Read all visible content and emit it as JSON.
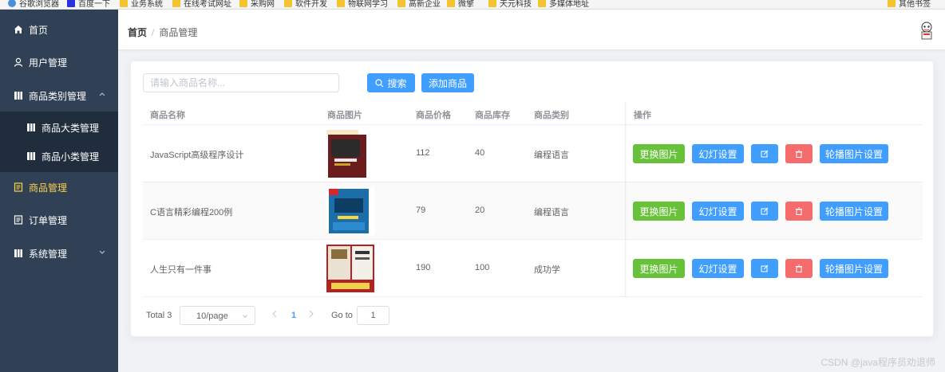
{
  "bookmarks": [
    "谷歌浏览器",
    "百度一下",
    "业务系统",
    "在线考试网址",
    "采购网",
    "软件开发",
    "物联网学习",
    "高新企业",
    "微擎",
    "天元科技",
    "多媒体地址",
    "其他书签"
  ],
  "sidebar": {
    "items": [
      {
        "label": "首页",
        "icon": "home-icon"
      },
      {
        "label": "用户管理",
        "icon": "user-icon"
      },
      {
        "label": "商品类别管理",
        "icon": "category-icon"
      },
      {
        "label": "商品大类管理",
        "icon": "category-icon"
      },
      {
        "label": "商品小类管理",
        "icon": "category-icon"
      },
      {
        "label": "商品管理",
        "icon": "document-icon"
      },
      {
        "label": "订单管理",
        "icon": "document-icon"
      },
      {
        "label": "系统管理",
        "icon": "settings-icon"
      }
    ],
    "active_color": "#ffd04b",
    "background": "#304156"
  },
  "header": {
    "breadcrumb": [
      "首页",
      "商品管理"
    ]
  },
  "toolbar": {
    "search_placeholder": "请输入商品名称...",
    "search_label": "搜索",
    "add_label": "添加商品"
  },
  "table": {
    "columns": [
      "商品名称",
      "商品图片",
      "商品价格",
      "商品库存",
      "商品类别",
      "操作"
    ],
    "rows": [
      {
        "name": "JavaScript高级程序设计",
        "price": "112",
        "stock": "40",
        "category": "编程语言"
      },
      {
        "name": "C语言精彩编程200例",
        "price": "79",
        "stock": "20",
        "category": "编程语言"
      },
      {
        "name": "人生只有一件事",
        "price": "190",
        "stock": "100",
        "category": "成功学"
      }
    ],
    "actions": {
      "change_image": "更换图片",
      "slide_settings": "幻灯设置",
      "carousel_settings": "轮播图片设置"
    }
  },
  "pagination": {
    "total": "Total 3",
    "page_size": "10/page",
    "current_page": "1",
    "goto_label": "Go to",
    "goto_value": "1"
  },
  "watermark": "CSDN @java程序员劝退师",
  "colors": {
    "primary": "#409eff",
    "success": "#67c23a",
    "danger": "#f56c6c"
  }
}
